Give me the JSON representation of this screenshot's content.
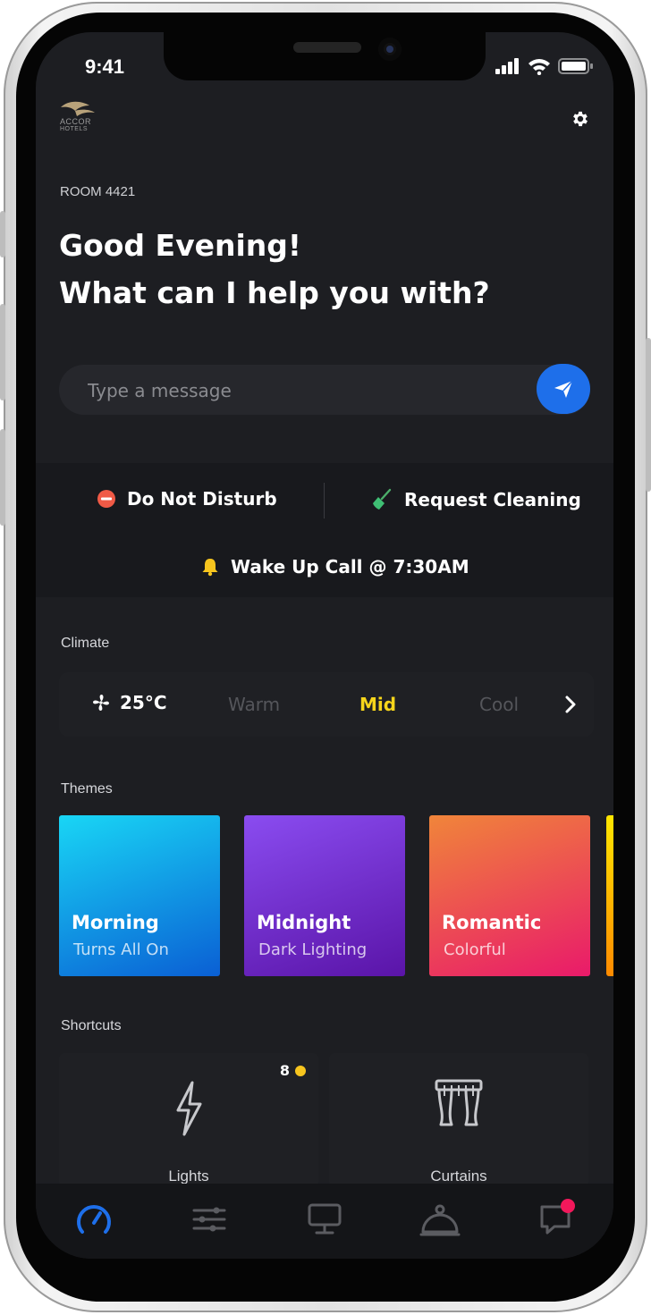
{
  "status_bar": {
    "time": "9:41"
  },
  "brand": {
    "logo_text_line1": "ACCOR",
    "logo_text_line2": "HOTELS"
  },
  "header": {
    "room": "ROOM 4421",
    "greeting_line1": "Good Evening!",
    "greeting_line2": "What can I help you with?"
  },
  "message": {
    "placeholder": "Type a message"
  },
  "quick_actions": {
    "dnd_label": "Do Not Disturb",
    "cleaning_label": "Request Cleaning",
    "wakeup_label": "Wake Up Call @ 7:30AM"
  },
  "climate": {
    "section_label": "Climate",
    "temperature": "25°C",
    "options": [
      "Warm",
      "Mid",
      "Cool"
    ],
    "selected": "Mid"
  },
  "themes": {
    "section_label": "Themes",
    "items": [
      {
        "title": "Morning",
        "subtitle": "Turns All On"
      },
      {
        "title": "Midnight",
        "subtitle": "Dark Lighting"
      },
      {
        "title": "Romantic",
        "subtitle": "Colorful"
      }
    ]
  },
  "shortcuts": {
    "section_label": "Shortcuts",
    "items": [
      {
        "label": "Lights",
        "count": "8"
      },
      {
        "label": "Curtains"
      }
    ]
  },
  "tab_bar": {
    "items": [
      "dashboard-icon",
      "controls-icon",
      "tv-icon",
      "room-service-icon",
      "chat-icon"
    ],
    "active": "dashboard-icon"
  },
  "colors": {
    "accent": "#1e6fea",
    "selected_option": "#f6d51b",
    "notification": "#f2185b",
    "morning_gradient": [
      "#19d6f5",
      "#0a5fd4"
    ],
    "midnight_gradient": [
      "#8a4cf0",
      "#5a14a8"
    ],
    "romantic_gradient": [
      "#f0853a",
      "#e91a6a"
    ]
  }
}
